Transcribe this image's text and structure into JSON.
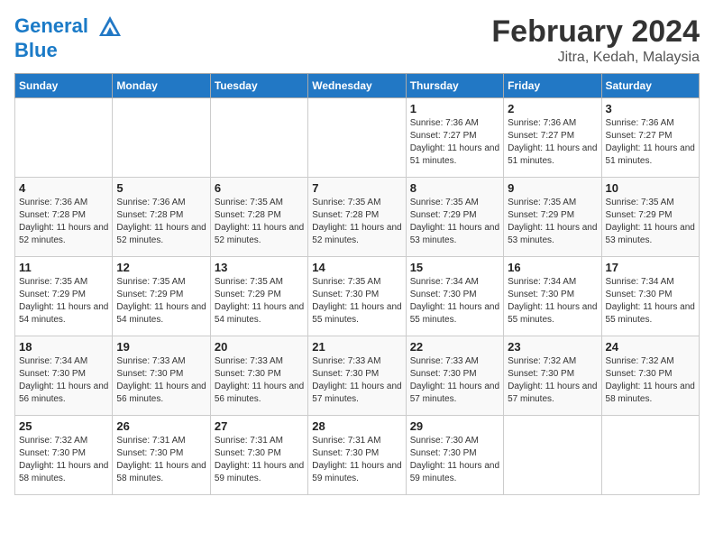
{
  "header": {
    "logo_line1": "General",
    "logo_line2": "Blue",
    "month_title": "February 2024",
    "location": "Jitra, Kedah, Malaysia"
  },
  "weekdays": [
    "Sunday",
    "Monday",
    "Tuesday",
    "Wednesday",
    "Thursday",
    "Friday",
    "Saturday"
  ],
  "weeks": [
    [
      {
        "day": "",
        "sunrise": "",
        "sunset": "",
        "daylight": ""
      },
      {
        "day": "",
        "sunrise": "",
        "sunset": "",
        "daylight": ""
      },
      {
        "day": "",
        "sunrise": "",
        "sunset": "",
        "daylight": ""
      },
      {
        "day": "",
        "sunrise": "",
        "sunset": "",
        "daylight": ""
      },
      {
        "day": "1",
        "sunrise": "Sunrise: 7:36 AM",
        "sunset": "Sunset: 7:27 PM",
        "daylight": "Daylight: 11 hours and 51 minutes."
      },
      {
        "day": "2",
        "sunrise": "Sunrise: 7:36 AM",
        "sunset": "Sunset: 7:27 PM",
        "daylight": "Daylight: 11 hours and 51 minutes."
      },
      {
        "day": "3",
        "sunrise": "Sunrise: 7:36 AM",
        "sunset": "Sunset: 7:27 PM",
        "daylight": "Daylight: 11 hours and 51 minutes."
      }
    ],
    [
      {
        "day": "4",
        "sunrise": "Sunrise: 7:36 AM",
        "sunset": "Sunset: 7:28 PM",
        "daylight": "Daylight: 11 hours and 52 minutes."
      },
      {
        "day": "5",
        "sunrise": "Sunrise: 7:36 AM",
        "sunset": "Sunset: 7:28 PM",
        "daylight": "Daylight: 11 hours and 52 minutes."
      },
      {
        "day": "6",
        "sunrise": "Sunrise: 7:35 AM",
        "sunset": "Sunset: 7:28 PM",
        "daylight": "Daylight: 11 hours and 52 minutes."
      },
      {
        "day": "7",
        "sunrise": "Sunrise: 7:35 AM",
        "sunset": "Sunset: 7:28 PM",
        "daylight": "Daylight: 11 hours and 52 minutes."
      },
      {
        "day": "8",
        "sunrise": "Sunrise: 7:35 AM",
        "sunset": "Sunset: 7:29 PM",
        "daylight": "Daylight: 11 hours and 53 minutes."
      },
      {
        "day": "9",
        "sunrise": "Sunrise: 7:35 AM",
        "sunset": "Sunset: 7:29 PM",
        "daylight": "Daylight: 11 hours and 53 minutes."
      },
      {
        "day": "10",
        "sunrise": "Sunrise: 7:35 AM",
        "sunset": "Sunset: 7:29 PM",
        "daylight": "Daylight: 11 hours and 53 minutes."
      }
    ],
    [
      {
        "day": "11",
        "sunrise": "Sunrise: 7:35 AM",
        "sunset": "Sunset: 7:29 PM",
        "daylight": "Daylight: 11 hours and 54 minutes."
      },
      {
        "day": "12",
        "sunrise": "Sunrise: 7:35 AM",
        "sunset": "Sunset: 7:29 PM",
        "daylight": "Daylight: 11 hours and 54 minutes."
      },
      {
        "day": "13",
        "sunrise": "Sunrise: 7:35 AM",
        "sunset": "Sunset: 7:29 PM",
        "daylight": "Daylight: 11 hours and 54 minutes."
      },
      {
        "day": "14",
        "sunrise": "Sunrise: 7:35 AM",
        "sunset": "Sunset: 7:30 PM",
        "daylight": "Daylight: 11 hours and 55 minutes."
      },
      {
        "day": "15",
        "sunrise": "Sunrise: 7:34 AM",
        "sunset": "Sunset: 7:30 PM",
        "daylight": "Daylight: 11 hours and 55 minutes."
      },
      {
        "day": "16",
        "sunrise": "Sunrise: 7:34 AM",
        "sunset": "Sunset: 7:30 PM",
        "daylight": "Daylight: 11 hours and 55 minutes."
      },
      {
        "day": "17",
        "sunrise": "Sunrise: 7:34 AM",
        "sunset": "Sunset: 7:30 PM",
        "daylight": "Daylight: 11 hours and 55 minutes."
      }
    ],
    [
      {
        "day": "18",
        "sunrise": "Sunrise: 7:34 AM",
        "sunset": "Sunset: 7:30 PM",
        "daylight": "Daylight: 11 hours and 56 minutes."
      },
      {
        "day": "19",
        "sunrise": "Sunrise: 7:33 AM",
        "sunset": "Sunset: 7:30 PM",
        "daylight": "Daylight: 11 hours and 56 minutes."
      },
      {
        "day": "20",
        "sunrise": "Sunrise: 7:33 AM",
        "sunset": "Sunset: 7:30 PM",
        "daylight": "Daylight: 11 hours and 56 minutes."
      },
      {
        "day": "21",
        "sunrise": "Sunrise: 7:33 AM",
        "sunset": "Sunset: 7:30 PM",
        "daylight": "Daylight: 11 hours and 57 minutes."
      },
      {
        "day": "22",
        "sunrise": "Sunrise: 7:33 AM",
        "sunset": "Sunset: 7:30 PM",
        "daylight": "Daylight: 11 hours and 57 minutes."
      },
      {
        "day": "23",
        "sunrise": "Sunrise: 7:32 AM",
        "sunset": "Sunset: 7:30 PM",
        "daylight": "Daylight: 11 hours and 57 minutes."
      },
      {
        "day": "24",
        "sunrise": "Sunrise: 7:32 AM",
        "sunset": "Sunset: 7:30 PM",
        "daylight": "Daylight: 11 hours and 58 minutes."
      }
    ],
    [
      {
        "day": "25",
        "sunrise": "Sunrise: 7:32 AM",
        "sunset": "Sunset: 7:30 PM",
        "daylight": "Daylight: 11 hours and 58 minutes."
      },
      {
        "day": "26",
        "sunrise": "Sunrise: 7:31 AM",
        "sunset": "Sunset: 7:30 PM",
        "daylight": "Daylight: 11 hours and 58 minutes."
      },
      {
        "day": "27",
        "sunrise": "Sunrise: 7:31 AM",
        "sunset": "Sunset: 7:30 PM",
        "daylight": "Daylight: 11 hours and 59 minutes."
      },
      {
        "day": "28",
        "sunrise": "Sunrise: 7:31 AM",
        "sunset": "Sunset: 7:30 PM",
        "daylight": "Daylight: 11 hours and 59 minutes."
      },
      {
        "day": "29",
        "sunrise": "Sunrise: 7:30 AM",
        "sunset": "Sunset: 7:30 PM",
        "daylight": "Daylight: 11 hours and 59 minutes."
      },
      {
        "day": "",
        "sunrise": "",
        "sunset": "",
        "daylight": ""
      },
      {
        "day": "",
        "sunrise": "",
        "sunset": "",
        "daylight": ""
      }
    ]
  ]
}
